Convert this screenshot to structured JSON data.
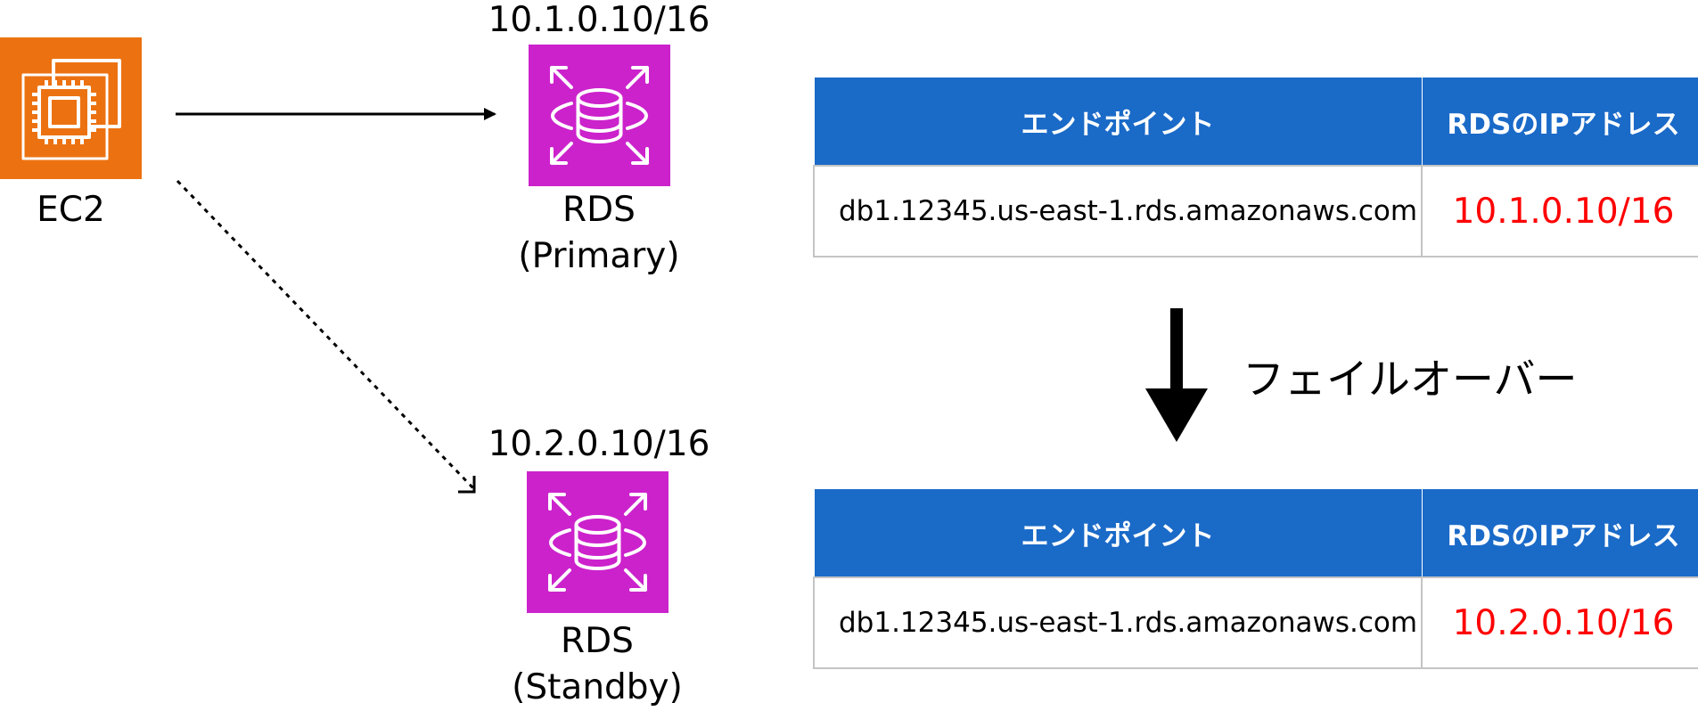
{
  "diagram": {
    "ec2": {
      "label": "EC2",
      "icon": "ec2-chip-icon",
      "color": "#ec7211"
    },
    "rds_primary": {
      "ip": "10.1.0.10/16",
      "label_line1": "RDS",
      "label_line2": "(Primary)",
      "icon": "rds-database-icon",
      "color": "#cc22cc"
    },
    "rds_standby": {
      "ip": "10.2.0.10/16",
      "label_line1": "RDS",
      "label_line2": "(Standby)",
      "icon": "rds-database-icon",
      "color": "#cc22cc"
    },
    "connections": [
      {
        "from": "EC2",
        "to": "RDS (Primary)",
        "style": "solid"
      },
      {
        "from": "EC2",
        "to": "RDS (Standby)",
        "style": "dotted"
      }
    ]
  },
  "tables": {
    "before": {
      "headers": [
        "エンドポイント",
        "RDSのIPアドレス"
      ],
      "row": {
        "endpoint": "db1.12345.us-east-1.rds.amazonaws.com",
        "ip": "10.1.0.10/16"
      }
    },
    "after": {
      "headers": [
        "エンドポイント",
        "RDSのIPアドレス"
      ],
      "row": {
        "endpoint": "db1.12345.us-east-1.rds.amazonaws.com",
        "ip": "10.2.0.10/16"
      }
    }
  },
  "failover": {
    "label": "フェイルオーバー",
    "icon": "down-arrow-icon"
  },
  "colors": {
    "header_bg": "#1a6ac8",
    "ip_text": "#ff0000",
    "border": "#c4c4c4"
  }
}
